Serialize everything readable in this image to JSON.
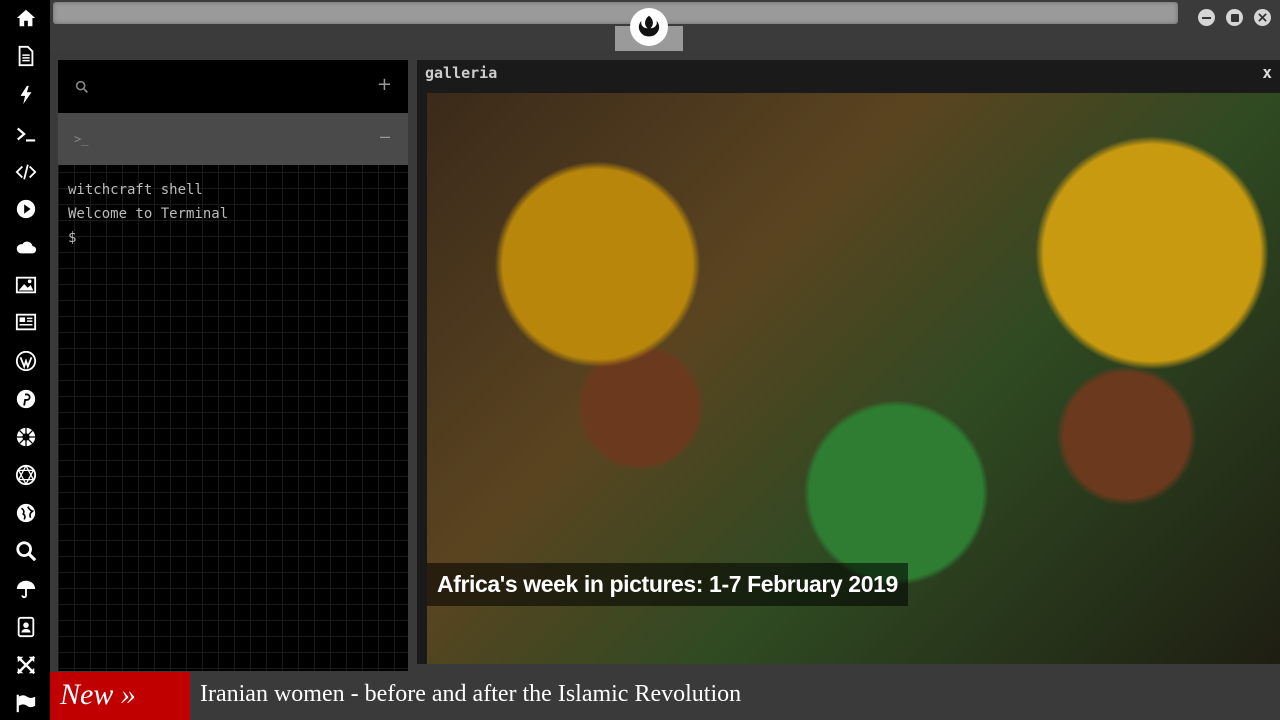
{
  "sidebar": {
    "icons": [
      "home-icon",
      "document-icon",
      "bolt-icon",
      "terminal-icon",
      "code-icon",
      "play-icon",
      "cloud-icon",
      "image-icon",
      "newspaper-icon",
      "wordpress-icon",
      "pinterest-icon",
      "galactic-empire-icon",
      "network-icon",
      "globe-icon",
      "search-icon",
      "umbrella-icon",
      "contacts-icon",
      "expand-icon",
      "flag-icon"
    ]
  },
  "window": {
    "logo_icon": "rebel-alliance-icon"
  },
  "terminal": {
    "add_label": "+",
    "prompt_label": ">_",
    "collapse_label": "–",
    "lines": [
      "witchcraft shell",
      "Welcome to Terminal",
      "$"
    ]
  },
  "gallery": {
    "title": "galleria",
    "close_label": "x",
    "caption": "Africa's week in pictures: 1-7 February 2019"
  },
  "ticker": {
    "tag": "New »",
    "headline": "Iranian women - before and after the Islamic Revolution",
    "tag_color": "#c00000"
  }
}
